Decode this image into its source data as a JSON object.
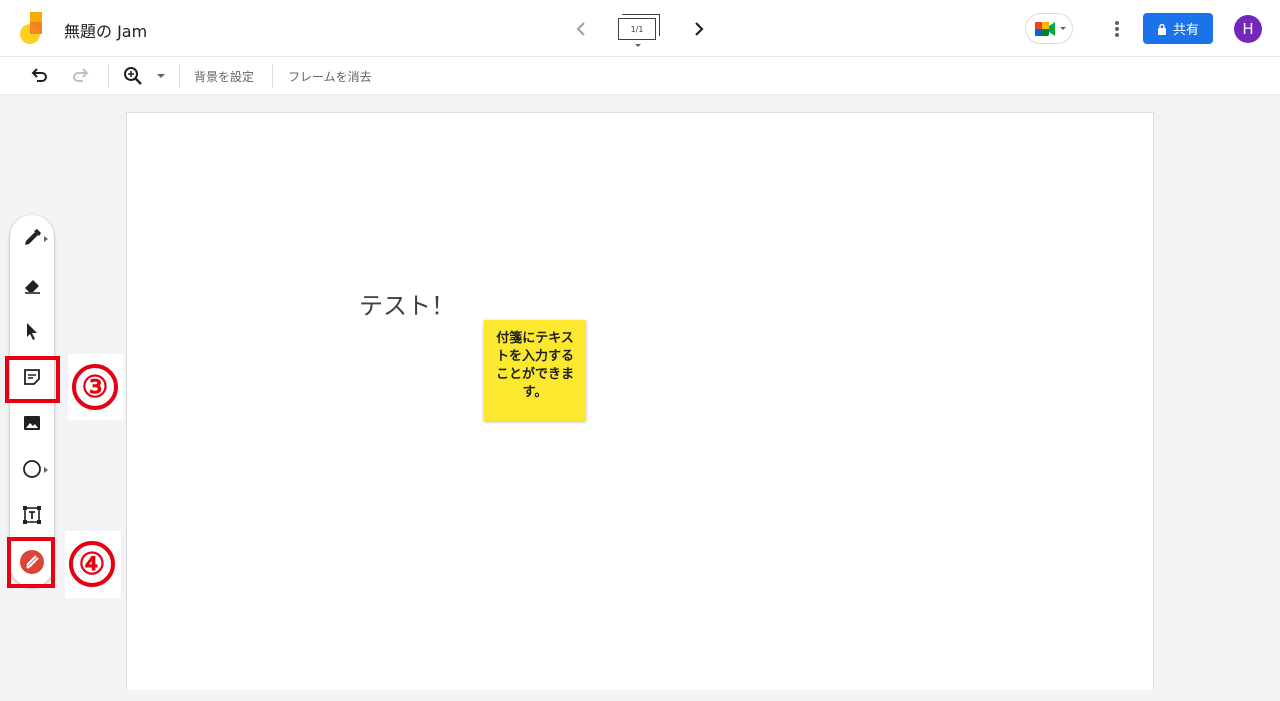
{
  "app": {
    "doc_title": "無題の Jam",
    "frame_indicator": "1/1"
  },
  "header": {
    "share_label": "共有",
    "avatar_initial": "H"
  },
  "toolbar": {
    "background_label": "背景を設定",
    "clear_frame_label": "フレームを消去"
  },
  "canvas": {
    "text": "テスト！",
    "sticky_note": "付箋にテキストを入力することができます。"
  },
  "tools": [
    {
      "name": "pen-tool",
      "icon": "pen-icon"
    },
    {
      "name": "eraser-tool",
      "icon": "eraser-icon"
    },
    {
      "name": "select-tool",
      "icon": "cursor-icon"
    },
    {
      "name": "sticky-note-tool",
      "icon": "sticky-note-icon"
    },
    {
      "name": "image-tool",
      "icon": "image-icon"
    },
    {
      "name": "shape-tool",
      "icon": "circle-icon"
    },
    {
      "name": "text-box-tool",
      "icon": "text-box-icon"
    },
    {
      "name": "laser-tool",
      "icon": "laser-pointer-icon"
    }
  ],
  "annotations": {
    "callout_3": "③",
    "callout_4": "④"
  },
  "colors": {
    "accent": "#1a73e8",
    "sticky": "#fde830",
    "highlight": "#e60012",
    "laser": "#db4437",
    "avatar": "#7627bb"
  }
}
